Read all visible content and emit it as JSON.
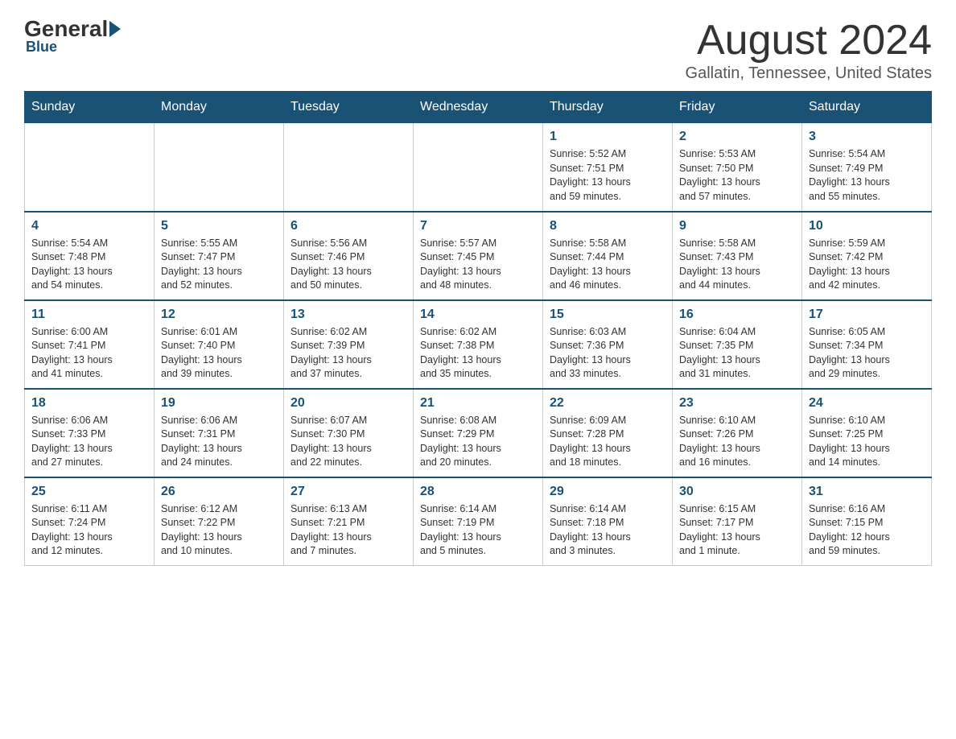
{
  "header": {
    "logo_general": "General",
    "logo_blue": "Blue",
    "month_title": "August 2024",
    "location": "Gallatin, Tennessee, United States"
  },
  "days_of_week": [
    "Sunday",
    "Monday",
    "Tuesday",
    "Wednesday",
    "Thursday",
    "Friday",
    "Saturday"
  ],
  "weeks": [
    {
      "days": [
        {
          "num": "",
          "info": ""
        },
        {
          "num": "",
          "info": ""
        },
        {
          "num": "",
          "info": ""
        },
        {
          "num": "",
          "info": ""
        },
        {
          "num": "1",
          "info": "Sunrise: 5:52 AM\nSunset: 7:51 PM\nDaylight: 13 hours\nand 59 minutes."
        },
        {
          "num": "2",
          "info": "Sunrise: 5:53 AM\nSunset: 7:50 PM\nDaylight: 13 hours\nand 57 minutes."
        },
        {
          "num": "3",
          "info": "Sunrise: 5:54 AM\nSunset: 7:49 PM\nDaylight: 13 hours\nand 55 minutes."
        }
      ]
    },
    {
      "days": [
        {
          "num": "4",
          "info": "Sunrise: 5:54 AM\nSunset: 7:48 PM\nDaylight: 13 hours\nand 54 minutes."
        },
        {
          "num": "5",
          "info": "Sunrise: 5:55 AM\nSunset: 7:47 PM\nDaylight: 13 hours\nand 52 minutes."
        },
        {
          "num": "6",
          "info": "Sunrise: 5:56 AM\nSunset: 7:46 PM\nDaylight: 13 hours\nand 50 minutes."
        },
        {
          "num": "7",
          "info": "Sunrise: 5:57 AM\nSunset: 7:45 PM\nDaylight: 13 hours\nand 48 minutes."
        },
        {
          "num": "8",
          "info": "Sunrise: 5:58 AM\nSunset: 7:44 PM\nDaylight: 13 hours\nand 46 minutes."
        },
        {
          "num": "9",
          "info": "Sunrise: 5:58 AM\nSunset: 7:43 PM\nDaylight: 13 hours\nand 44 minutes."
        },
        {
          "num": "10",
          "info": "Sunrise: 5:59 AM\nSunset: 7:42 PM\nDaylight: 13 hours\nand 42 minutes."
        }
      ]
    },
    {
      "days": [
        {
          "num": "11",
          "info": "Sunrise: 6:00 AM\nSunset: 7:41 PM\nDaylight: 13 hours\nand 41 minutes."
        },
        {
          "num": "12",
          "info": "Sunrise: 6:01 AM\nSunset: 7:40 PM\nDaylight: 13 hours\nand 39 minutes."
        },
        {
          "num": "13",
          "info": "Sunrise: 6:02 AM\nSunset: 7:39 PM\nDaylight: 13 hours\nand 37 minutes."
        },
        {
          "num": "14",
          "info": "Sunrise: 6:02 AM\nSunset: 7:38 PM\nDaylight: 13 hours\nand 35 minutes."
        },
        {
          "num": "15",
          "info": "Sunrise: 6:03 AM\nSunset: 7:36 PM\nDaylight: 13 hours\nand 33 minutes."
        },
        {
          "num": "16",
          "info": "Sunrise: 6:04 AM\nSunset: 7:35 PM\nDaylight: 13 hours\nand 31 minutes."
        },
        {
          "num": "17",
          "info": "Sunrise: 6:05 AM\nSunset: 7:34 PM\nDaylight: 13 hours\nand 29 minutes."
        }
      ]
    },
    {
      "days": [
        {
          "num": "18",
          "info": "Sunrise: 6:06 AM\nSunset: 7:33 PM\nDaylight: 13 hours\nand 27 minutes."
        },
        {
          "num": "19",
          "info": "Sunrise: 6:06 AM\nSunset: 7:31 PM\nDaylight: 13 hours\nand 24 minutes."
        },
        {
          "num": "20",
          "info": "Sunrise: 6:07 AM\nSunset: 7:30 PM\nDaylight: 13 hours\nand 22 minutes."
        },
        {
          "num": "21",
          "info": "Sunrise: 6:08 AM\nSunset: 7:29 PM\nDaylight: 13 hours\nand 20 minutes."
        },
        {
          "num": "22",
          "info": "Sunrise: 6:09 AM\nSunset: 7:28 PM\nDaylight: 13 hours\nand 18 minutes."
        },
        {
          "num": "23",
          "info": "Sunrise: 6:10 AM\nSunset: 7:26 PM\nDaylight: 13 hours\nand 16 minutes."
        },
        {
          "num": "24",
          "info": "Sunrise: 6:10 AM\nSunset: 7:25 PM\nDaylight: 13 hours\nand 14 minutes."
        }
      ]
    },
    {
      "days": [
        {
          "num": "25",
          "info": "Sunrise: 6:11 AM\nSunset: 7:24 PM\nDaylight: 13 hours\nand 12 minutes."
        },
        {
          "num": "26",
          "info": "Sunrise: 6:12 AM\nSunset: 7:22 PM\nDaylight: 13 hours\nand 10 minutes."
        },
        {
          "num": "27",
          "info": "Sunrise: 6:13 AM\nSunset: 7:21 PM\nDaylight: 13 hours\nand 7 minutes."
        },
        {
          "num": "28",
          "info": "Sunrise: 6:14 AM\nSunset: 7:19 PM\nDaylight: 13 hours\nand 5 minutes."
        },
        {
          "num": "29",
          "info": "Sunrise: 6:14 AM\nSunset: 7:18 PM\nDaylight: 13 hours\nand 3 minutes."
        },
        {
          "num": "30",
          "info": "Sunrise: 6:15 AM\nSunset: 7:17 PM\nDaylight: 13 hours\nand 1 minute."
        },
        {
          "num": "31",
          "info": "Sunrise: 6:16 AM\nSunset: 7:15 PM\nDaylight: 12 hours\nand 59 minutes."
        }
      ]
    }
  ]
}
